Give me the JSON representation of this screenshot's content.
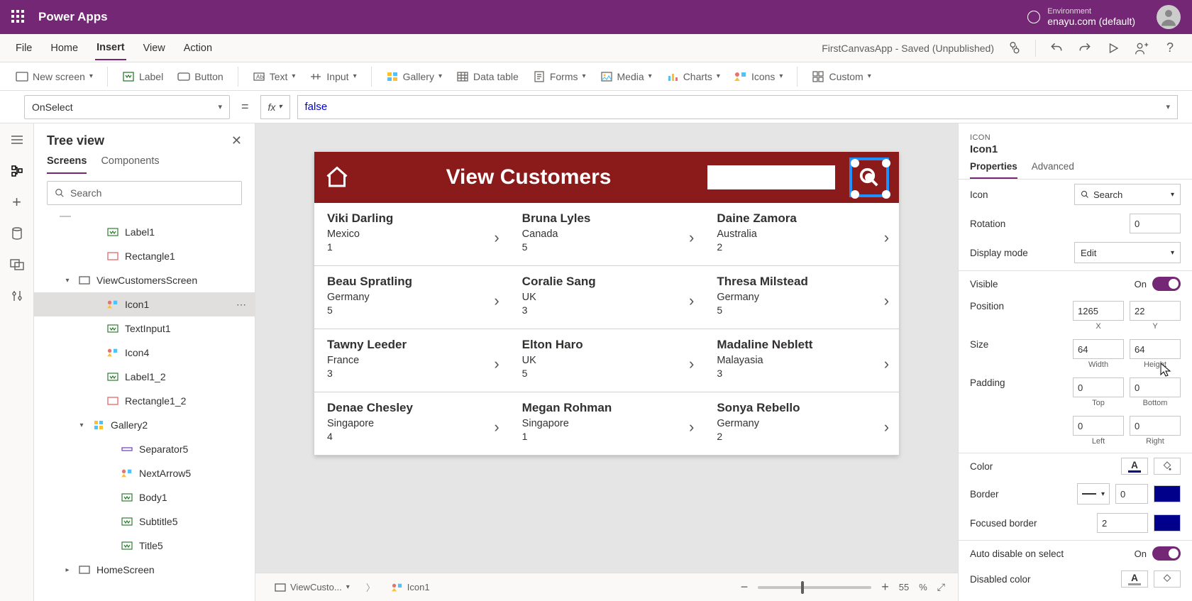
{
  "header": {
    "appName": "Power Apps",
    "envLabel": "Environment",
    "envValue": "enayu.com (default)"
  },
  "menu": {
    "items": [
      "File",
      "Home",
      "Insert",
      "View",
      "Action"
    ],
    "active": "Insert",
    "status": "FirstCanvasApp - Saved (Unpublished)"
  },
  "ribbon": {
    "newScreen": "New screen",
    "label": "Label",
    "button": "Button",
    "text": "Text",
    "input": "Input",
    "gallery": "Gallery",
    "dataTable": "Data table",
    "forms": "Forms",
    "media": "Media",
    "charts": "Charts",
    "icons": "Icons",
    "custom": "Custom"
  },
  "formula": {
    "property": "OnSelect",
    "value": "false"
  },
  "tree": {
    "title": "Tree view",
    "tabs": [
      "Screens",
      "Components"
    ],
    "activeTab": "Screens",
    "searchPlaceholder": "Search",
    "nodes": [
      {
        "label": "Label1",
        "depth": 3,
        "icon": "label"
      },
      {
        "label": "Rectangle1",
        "depth": 3,
        "icon": "rect"
      },
      {
        "label": "ViewCustomersScreen",
        "depth": 1,
        "icon": "screen",
        "expand": "open"
      },
      {
        "label": "Icon1",
        "depth": 3,
        "icon": "icons",
        "selected": true,
        "more": true
      },
      {
        "label": "TextInput1",
        "depth": 3,
        "icon": "label"
      },
      {
        "label": "Icon4",
        "depth": 3,
        "icon": "icons"
      },
      {
        "label": "Label1_2",
        "depth": 3,
        "icon": "label"
      },
      {
        "label": "Rectangle1_2",
        "depth": 3,
        "icon": "rect"
      },
      {
        "label": "Gallery2",
        "depth": 2,
        "icon": "gallery",
        "expand": "open"
      },
      {
        "label": "Separator5",
        "depth": 4,
        "icon": "sep"
      },
      {
        "label": "NextArrow5",
        "depth": 4,
        "icon": "icons"
      },
      {
        "label": "Body1",
        "depth": 4,
        "icon": "label"
      },
      {
        "label": "Subtitle5",
        "depth": 4,
        "icon": "label"
      },
      {
        "label": "Title5",
        "depth": 4,
        "icon": "label"
      },
      {
        "label": "HomeScreen",
        "depth": 1,
        "icon": "screen",
        "expand": "closed"
      }
    ]
  },
  "canvas": {
    "headerTitle": "View Customers",
    "customers": [
      [
        {
          "name": "Viki Darling",
          "country": "Mexico",
          "n": "1"
        },
        {
          "name": "Bruna Lyles",
          "country": "Canada",
          "n": "5"
        },
        {
          "name": "Daine Zamora",
          "country": "Australia",
          "n": "2"
        }
      ],
      [
        {
          "name": "Beau Spratling",
          "country": "Germany",
          "n": "5"
        },
        {
          "name": "Coralie Sang",
          "country": "UK",
          "n": "3"
        },
        {
          "name": "Thresa Milstead",
          "country": "Germany",
          "n": "5"
        }
      ],
      [
        {
          "name": "Tawny Leeder",
          "country": "France",
          "n": "3"
        },
        {
          "name": "Elton Haro",
          "country": "UK",
          "n": "5"
        },
        {
          "name": "Madaline Neblett",
          "country": "Malayasia",
          "n": "3"
        }
      ],
      [
        {
          "name": "Denae Chesley",
          "country": "Singapore",
          "n": "4"
        },
        {
          "name": "Megan Rohman",
          "country": "Singapore",
          "n": "1"
        },
        {
          "name": "Sonya Rebello",
          "country": "Germany",
          "n": "2"
        }
      ]
    ]
  },
  "canvasFoot": {
    "screen": "ViewCusto...",
    "selected": "Icon1",
    "zoom": "55",
    "zoomUnit": "%"
  },
  "props": {
    "typeLabel": "ICON",
    "name": "Icon1",
    "tabs": [
      "Properties",
      "Advanced"
    ],
    "activeTab": "Properties",
    "iconLabel": "Icon",
    "iconValue": "Search",
    "rotationLabel": "Rotation",
    "rotationValue": "0",
    "displayModeLabel": "Display mode",
    "displayModeValue": "Edit",
    "visibleLabel": "Visible",
    "visibleOn": "On",
    "positionLabel": "Position",
    "posX": "1265",
    "posY": "22",
    "posXl": "X",
    "posYl": "Y",
    "sizeLabel": "Size",
    "sizeW": "64",
    "sizeH": "64",
    "sizeWl": "Width",
    "sizeHl": "Height",
    "paddingLabel": "Padding",
    "padT": "0",
    "padB": "0",
    "padL": "0",
    "padR": "0",
    "padTl": "Top",
    "padBl": "Bottom",
    "padLl": "Left",
    "padRl": "Right",
    "colorLabel": "Color",
    "borderLabel": "Border",
    "borderW": "0",
    "focusedBorderLabel": "Focused border",
    "focusedBorderW": "2",
    "autoDisableLabel": "Auto disable on select",
    "autoDisableOn": "On",
    "disabledColorLabel": "Disabled color"
  }
}
